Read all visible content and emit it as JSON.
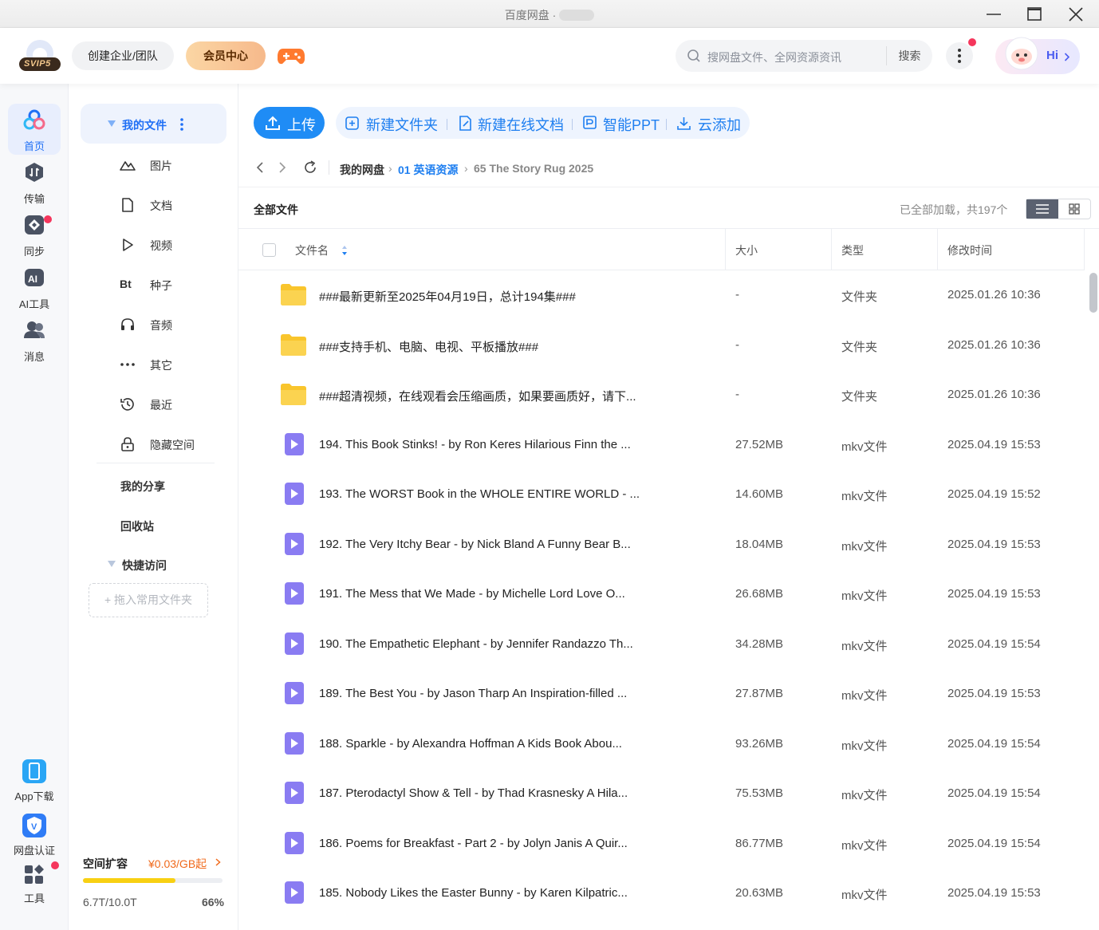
{
  "window": {
    "title": "百度网盘 ·"
  },
  "topbar": {
    "logo_text": "SVIP5",
    "team_label": "创建企业/团队",
    "vip_label": "会员中心",
    "search_placeholder": "搜网盘文件、全网资源资讯",
    "search_button": "搜索",
    "hi_label": "Hi"
  },
  "leftnav": {
    "items": [
      {
        "label": "首页",
        "icon": "home-icon"
      },
      {
        "label": "传输",
        "icon": "transfer-icon"
      },
      {
        "label": "同步",
        "icon": "sync-icon"
      },
      {
        "label": "AI工具",
        "icon": "ai-icon"
      },
      {
        "label": "消息",
        "icon": "message-icon"
      }
    ],
    "bottom": [
      {
        "label": "App下载",
        "icon": "phone-icon"
      },
      {
        "label": "网盘认证",
        "icon": "verify-icon"
      },
      {
        "label": "工具",
        "icon": "apps-icon"
      }
    ]
  },
  "sidebar": {
    "my_files": "我的文件",
    "items": [
      {
        "label": "图片",
        "icon": "image-icon"
      },
      {
        "label": "文档",
        "icon": "doc-icon"
      },
      {
        "label": "视频",
        "icon": "video-icon"
      },
      {
        "label": "种子",
        "icon": "bt-icon",
        "glyph": "Bt"
      },
      {
        "label": "音频",
        "icon": "headphone-icon"
      },
      {
        "label": "其它",
        "icon": "more-icon"
      },
      {
        "label": "最近",
        "icon": "recent-icon"
      },
      {
        "label": "隐藏空间",
        "icon": "lock-icon"
      }
    ],
    "share": "我的分享",
    "recycle": "回收站",
    "quick_access": "快捷访问",
    "drop_hint": "+ 拖入常用文件夹",
    "quota": {
      "title": "空间扩容",
      "price": "¥0.03/GB起",
      "used": "6.7T/10.0T",
      "percent_label": "66%",
      "percent": 0.66
    }
  },
  "toolbar": {
    "upload": "上传",
    "new_folder": "新建文件夹",
    "new_doc": "新建在线文档",
    "ppt": "智能PPT",
    "cloud_add": "云添加"
  },
  "breadcrumb": {
    "root": "我的网盘",
    "level1": "01 英语资源",
    "current": "65 The Story Rug 2025"
  },
  "list": {
    "title": "全部文件",
    "status": "已全部加载，共197个",
    "columns": {
      "name": "文件名",
      "size": "大小",
      "type": "类型",
      "time": "修改时间"
    },
    "rows": [
      {
        "kind": "folder",
        "name": "###最新更新至2025年04月19日，总计194集###",
        "size": "-",
        "type": "文件夹",
        "time": "2025.01.26 10:36"
      },
      {
        "kind": "folder",
        "name": "###支持手机、电脑、电视、平板播放###",
        "size": "-",
        "type": "文件夹",
        "time": "2025.01.26 10:36"
      },
      {
        "kind": "folder",
        "name": "###超清视频，在线观看会压缩画质，如果要画质好，请下...",
        "size": "-",
        "type": "文件夹",
        "time": "2025.01.26 10:36"
      },
      {
        "kind": "video",
        "name": "194. This Book Stinks! - by Ron Keres Hilarious Finn the ...",
        "size": "27.52MB",
        "type": "mkv文件",
        "time": "2025.04.19 15:53"
      },
      {
        "kind": "video",
        "name": "193. The WORST Book in the WHOLE ENTIRE WORLD - ...",
        "size": "14.60MB",
        "type": "mkv文件",
        "time": "2025.04.19 15:52"
      },
      {
        "kind": "video",
        "name": "192. The Very Itchy Bear - by Nick Bland A Funny Bear B...",
        "size": "18.04MB",
        "type": "mkv文件",
        "time": "2025.04.19 15:53"
      },
      {
        "kind": "video",
        "name": "191. The Mess that We Made - by Michelle Lord Love O...",
        "size": "26.68MB",
        "type": "mkv文件",
        "time": "2025.04.19 15:53"
      },
      {
        "kind": "video",
        "name": "190. The Empathetic Elephant - by Jennifer Randazzo Th...",
        "size": "34.28MB",
        "type": "mkv文件",
        "time": "2025.04.19 15:54"
      },
      {
        "kind": "video",
        "name": "189. The Best You - by Jason Tharp An Inspiration-filled ...",
        "size": "27.87MB",
        "type": "mkv文件",
        "time": "2025.04.19 15:53"
      },
      {
        "kind": "video",
        "name": "188. Sparkle - by Alexandra Hoffman A Kids Book Abou...",
        "size": "93.26MB",
        "type": "mkv文件",
        "time": "2025.04.19 15:54"
      },
      {
        "kind": "video",
        "name": "187. Pterodactyl Show & Tell - by Thad Krasnesky A Hila...",
        "size": "75.53MB",
        "type": "mkv文件",
        "time": "2025.04.19 15:54"
      },
      {
        "kind": "video",
        "name": "186. Poems for Breakfast - Part 2 - by Jolyn Janis A Quir...",
        "size": "86.77MB",
        "type": "mkv文件",
        "time": "2025.04.19 15:54"
      },
      {
        "kind": "video",
        "name": "185. Nobody Likes the Easter Bunny - by Karen Kilpatric...",
        "size": "20.63MB",
        "type": "mkv文件",
        "time": "2025.04.19 15:53"
      }
    ]
  },
  "colors": {
    "accent": "#1f6ff5",
    "upload": "#1f8cf5",
    "folder": "#f9c52c",
    "video": "#8a7cf2",
    "quota_bar": "#f8d013"
  }
}
